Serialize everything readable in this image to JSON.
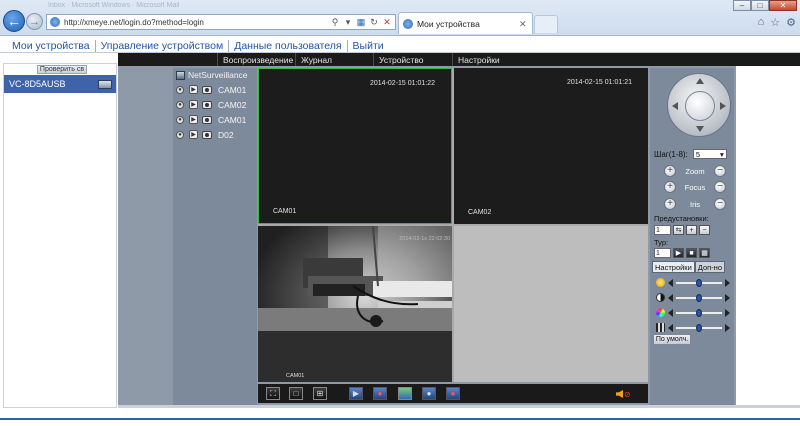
{
  "browser": {
    "url": "http://xmeye.net/login.do?method=login",
    "tab_title": "Мои устройства",
    "blurred_tabs": "Inbox · Microsoft Windows · Microsoft Mail"
  },
  "top_menu": [
    {
      "label": "Мои устройства"
    },
    {
      "label": "Управление устройством"
    },
    {
      "label": "Данные пользователя"
    },
    {
      "label": "Выйти"
    }
  ],
  "left_panel": {
    "check_button": "Проверить св",
    "device": "VC-8D5AUSB"
  },
  "app_tabs": [
    {
      "label": "Воспроизведение"
    },
    {
      "label": "Журнал"
    },
    {
      "label": "Устройство"
    },
    {
      "label": "Настройки"
    }
  ],
  "tree": {
    "root": "NetSurveillance",
    "channels": [
      {
        "label": "CAM01"
      },
      {
        "label": "CAM02"
      },
      {
        "label": "CAM01"
      },
      {
        "label": "D02"
      }
    ]
  },
  "tiles": [
    {
      "timestamp": "2014-02-15 01:01:22",
      "name": "CAM01"
    },
    {
      "timestamp": "2014-02-15 01:01:21",
      "name": "CAM02"
    },
    {
      "timestamp": "2014-02-1s 22:62:30",
      "name": "CAM01"
    }
  ],
  "ptz": {
    "step_label": "Шаг(1-8):",
    "step_value": "5",
    "zoom": "Zoom",
    "focus": "Focus",
    "iris": "Iris",
    "presets_label": "Предустановки:",
    "preset_value": "1",
    "tour_label": "Тур:",
    "tour_value": "1",
    "tab_settings": "Настройки",
    "tab_extra": "Доп-но",
    "default_button": "По умолч.",
    "sliders": [
      {
        "name": "brightness",
        "level": 0.5
      },
      {
        "name": "contrast",
        "level": 0.5
      },
      {
        "name": "saturation",
        "level": 0.5
      },
      {
        "name": "hue",
        "level": 0.5
      }
    ]
  },
  "colors": {
    "accent": "#3e63a8",
    "active_tile_border": "#3db43d",
    "menu_link": "#1e56a8"
  }
}
